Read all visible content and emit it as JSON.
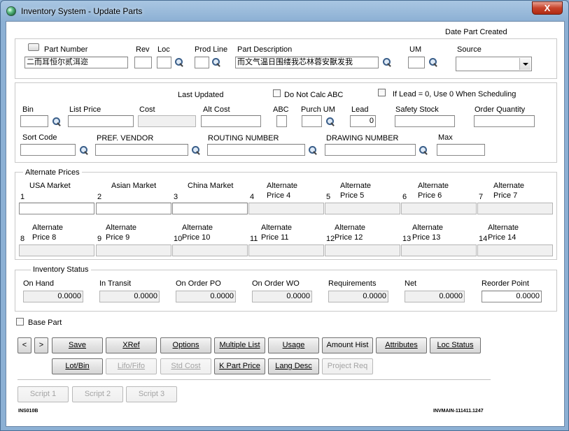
{
  "window": {
    "title": "Inventory System - Update Parts",
    "close_label": "X"
  },
  "header": {
    "date_part_created_label": "Date Part Created"
  },
  "part": {
    "part_number_label": "Part Number",
    "part_number_value": "二而耳恒尔贰洱迩",
    "rev_label": "Rev",
    "loc_label": "Loc",
    "prod_line_label": "Prod Line",
    "description_label": "Part Description",
    "description_value": "而文气温日围缕我芯林蓉安獸发我",
    "um_label": "UM",
    "source_label": "Source"
  },
  "details": {
    "last_updated_label": "Last Updated",
    "do_not_calc_abc_label": "Do Not Calc ABC",
    "if_lead_label": "If Lead = 0, Use 0 When Scheduling",
    "bin_label": "Bin",
    "list_price_label": "List Price",
    "cost_label": "Cost",
    "alt_cost_label": "Alt Cost",
    "abc_label": "ABC",
    "purch_um_label": "Purch UM",
    "lead_label": "Lead",
    "lead_value": "0",
    "safety_stock_label": "Safety Stock",
    "order_quantity_label": "Order Quantity",
    "sort_code_label": "Sort Code",
    "pref_vendor_label": "PREF. VENDOR",
    "routing_number_label": "ROUTING NUMBER",
    "drawing_number_label": "DRAWING NUMBER",
    "max_label": "Max"
  },
  "alternate_prices": {
    "title": "Alternate Prices",
    "row1": [
      {
        "num": "1",
        "line1": "USA Market",
        "line2": ""
      },
      {
        "num": "2",
        "line1": "Asian Market",
        "line2": ""
      },
      {
        "num": "3",
        "line1": "China Market",
        "line2": ""
      },
      {
        "num": "4",
        "line1": "Alternate",
        "line2": "Price 4"
      },
      {
        "num": "5",
        "line1": "Alternate",
        "line2": "Price 5"
      },
      {
        "num": "6",
        "line1": "Alternate",
        "line2": "Price 6"
      },
      {
        "num": "7",
        "line1": "Alternate",
        "line2": "Price 7"
      }
    ],
    "row2": [
      {
        "num": "8",
        "line1": "Alternate",
        "line2": "Price 8"
      },
      {
        "num": "9",
        "line1": "Alternate",
        "line2": "Price 9"
      },
      {
        "num": "10",
        "line1": "Alternate",
        "line2": "Price 10"
      },
      {
        "num": "11",
        "line1": "Alternate",
        "line2": "Price 11"
      },
      {
        "num": "12",
        "line1": "Alternate",
        "line2": "Price 12"
      },
      {
        "num": "13",
        "line1": "Alternate",
        "line2": "Price 13"
      },
      {
        "num": "14",
        "line1": "Alternate",
        "line2": "Price 14"
      }
    ]
  },
  "inventory_status": {
    "title": "Inventory Status",
    "fields": [
      {
        "label": "On Hand",
        "value": "0.0000"
      },
      {
        "label": "In Transit",
        "value": "0.0000"
      },
      {
        "label": "On Order PO",
        "value": "0.0000"
      },
      {
        "label": "On Order WO",
        "value": "0.0000"
      },
      {
        "label": "Requirements",
        "value": "0.0000"
      },
      {
        "label": "Net",
        "value": "0.0000"
      },
      {
        "label": "Reorder Point",
        "value": "0.0000"
      }
    ]
  },
  "base_part_label": "Base Part",
  "buttons": {
    "prev": "<",
    "next": ">",
    "save": "Save",
    "xref": "XRef",
    "options": "Options",
    "multiple_list": "Multiple List",
    "usage": "Usage",
    "amount_hist": "Amount Hist",
    "attributes": "Attributes",
    "loc_status": "Loc Status",
    "lot_bin": "Lot/Bin",
    "lifo_fifo": "Lifo/Fifo",
    "std_cost": "Std Cost",
    "k_part_price": "K Part Price",
    "lang_desc": "Lang Desc",
    "project_req": "Project Req",
    "script1": "Script 1",
    "script2": "Script 2",
    "script3": "Script 3"
  },
  "footer": {
    "left_code": "INS010B",
    "right_code": "INVMAIN-111411.1247"
  },
  "colors": {
    "title_bar": "#8cb0d4",
    "close_button": "#c7422a",
    "client_bg": "#ffffff"
  }
}
